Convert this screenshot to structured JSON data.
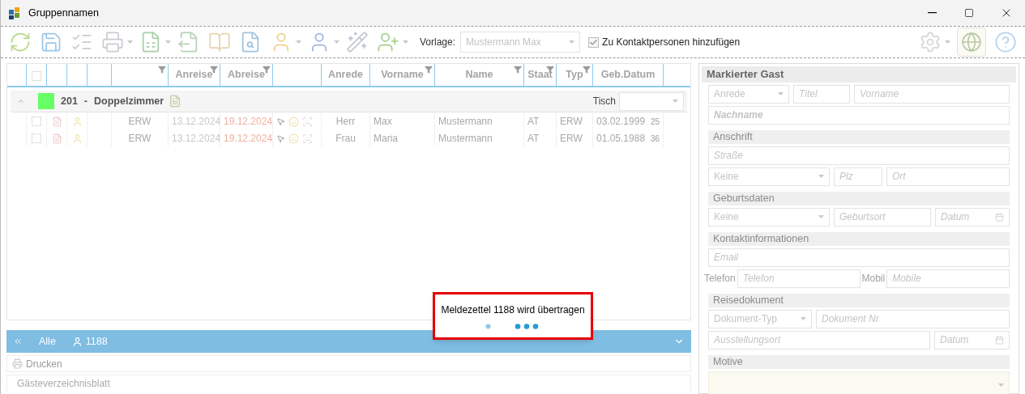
{
  "window": {
    "title": "Gruppennamen"
  },
  "toolbar": {
    "template_label": "Vorlage:",
    "template_value": "Mustermann Max",
    "contact_checkbox": {
      "label": "Zu Kontaktpersonen hinzufügen",
      "checked": true
    }
  },
  "grid": {
    "columns": [
      {
        "kind": "blank",
        "filter": false
      },
      {
        "kind": "checkbox",
        "filter": false,
        "checked": false
      },
      {
        "kind": "blank",
        "filter": false
      },
      {
        "kind": "blank",
        "filter": false
      },
      {
        "kind": "blank",
        "filter": false
      },
      {
        "kind": "blank",
        "filter": true
      },
      {
        "kind": "text",
        "label": "Anreise",
        "filter": true
      },
      {
        "kind": "text",
        "label": "Abreise",
        "filter": true
      },
      {
        "kind": "blank",
        "filter": false
      },
      {
        "kind": "text",
        "label": "Anrede",
        "filter": false
      },
      {
        "kind": "text",
        "label": "Vorname",
        "filter": true
      },
      {
        "kind": "text",
        "label": "Name",
        "filter": true
      },
      {
        "kind": "text",
        "label": "Staat",
        "filter": true
      },
      {
        "kind": "text",
        "label": "Typ",
        "filter": true
      },
      {
        "kind": "text",
        "label": "Geb.Datum",
        "filter": false
      }
    ],
    "group": {
      "color": "#66ff66",
      "number": "201",
      "separator": "-",
      "name": "Doppelzimmer",
      "table_label": "Tisch"
    },
    "rows": [
      {
        "checked": false,
        "board": "ERW",
        "arrival": "13.12.2024",
        "departure": "19.12.2024",
        "salutation": "Herr",
        "first_name": "Max",
        "last_name": "Mustermann",
        "country": "AT",
        "type": "ERW",
        "birth_date": "03.02.1999",
        "age": "25"
      },
      {
        "checked": false,
        "board": "ERW",
        "arrival": "13.12.2024",
        "departure": "19.12.2024",
        "salutation": "Frau",
        "first_name": "Maria",
        "last_name": "Mustermann",
        "country": "AT",
        "type": "ERW",
        "birth_date": "01.05.1988",
        "age": "36"
      }
    ]
  },
  "loading": {
    "message": "Meldezettel 1188 wird übertragen"
  },
  "filter_bar": {
    "all_label": "Alle",
    "count": "1188"
  },
  "print_toolbar": {
    "print_label": "Drucken"
  },
  "section_title": "Gästeverzeichnisblatt",
  "guest_panel": {
    "title": "Markierter Gast",
    "salutation": "Anrede",
    "title_field": "Titel",
    "first_name": "Vorname",
    "last_name": "Nachname",
    "address": {
      "heading": "Anschrift",
      "street": "Straße",
      "country": "Keine",
      "zip": "Plz",
      "city": "Ort"
    },
    "birth": {
      "heading": "Geburtsdaten",
      "country": "Keine",
      "place": "Geburtsort",
      "date": "Datum"
    },
    "contact": {
      "heading": "Kontaktinformationen",
      "email": "Email",
      "phone_label": "Telefon",
      "phone": "Telefon",
      "mobile_label": "Mobil",
      "mobile": "Mobile"
    },
    "document": {
      "heading": "Reisedokument",
      "type": "Dokument-Typ",
      "number": "Dokument Nr",
      "place": "Ausstellungsort",
      "date": "Datum"
    },
    "motives": {
      "heading": "Motive"
    }
  }
}
